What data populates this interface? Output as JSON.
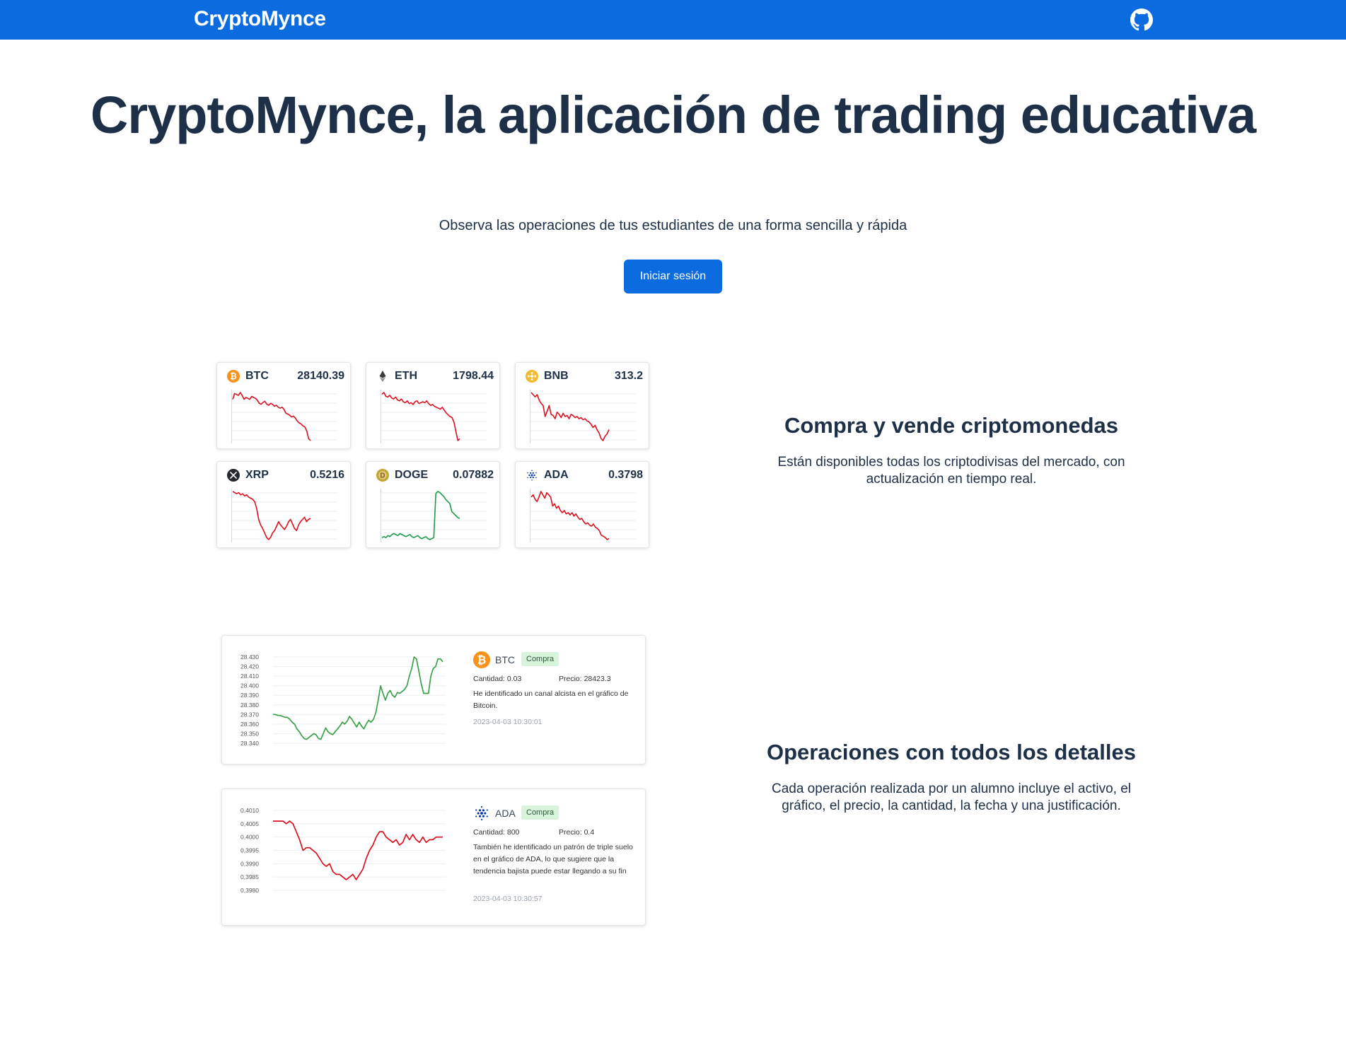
{
  "navbar": {
    "brand": "CryptoMynce",
    "github_icon": "github-icon",
    "bg_color": "#0b6bdf"
  },
  "hero": {
    "title": "CryptoMynce, la aplicación de trading educativa",
    "subtitle": "Observa las operaciones de tus estudiantes de una forma sencilla y rápida",
    "login_button": "Iniciar sesión"
  },
  "tickers": [
    {
      "symbol": "BTC",
      "price": "28140.39",
      "icon": "btc-icon",
      "trend": "down",
      "color": "#d9121f",
      "series": [
        52,
        58,
        57,
        56,
        59,
        56,
        52,
        54,
        53,
        52,
        55,
        54,
        53,
        51,
        48,
        47,
        49,
        50,
        47,
        46,
        48,
        47,
        45,
        46,
        44,
        43,
        44,
        42,
        38,
        37,
        36,
        34,
        35,
        33,
        30,
        28,
        27,
        25,
        24,
        20,
        12,
        10
      ]
    },
    {
      "symbol": "ETH",
      "price": "1798.44",
      "icon": "eth-icon",
      "trend": "down",
      "color": "#d9121f",
      "series": [
        60,
        62,
        58,
        57,
        59,
        56,
        55,
        57,
        54,
        53,
        55,
        52,
        51,
        53,
        50,
        51,
        49,
        52,
        53,
        50,
        51,
        52,
        51,
        53,
        50,
        48,
        49,
        47,
        46,
        45,
        44,
        46,
        43,
        40,
        38,
        36,
        35,
        30,
        20,
        10,
        12
      ]
    },
    {
      "symbol": "BNB",
      "price": "313.2",
      "icon": "bnb-icon",
      "trend": "down",
      "color": "#d9121f",
      "series": [
        62,
        60,
        58,
        60,
        55,
        52,
        50,
        40,
        45,
        50,
        42,
        41,
        38,
        44,
        42,
        39,
        43,
        40,
        41,
        38,
        42,
        41,
        39,
        40,
        38,
        39,
        37,
        38,
        36,
        35,
        33,
        30,
        32,
        28,
        25,
        20,
        18,
        22,
        24,
        28
      ]
    },
    {
      "symbol": "XRP",
      "price": "0.5216",
      "icon": "xrp-icon",
      "trend": "down",
      "color": "#d9121f",
      "series": [
        55,
        54,
        53,
        54,
        52,
        53,
        51,
        52,
        50,
        49,
        48,
        46,
        40,
        30,
        25,
        22,
        18,
        14,
        12,
        14,
        18,
        20,
        24,
        28,
        25,
        23,
        21,
        24,
        28,
        30,
        26,
        22,
        20,
        25,
        28,
        30,
        32,
        28,
        30,
        31
      ]
    },
    {
      "symbol": "DOGE",
      "price": "0.07882",
      "icon": "doge-icon",
      "trend": "up",
      "color": "#1f9a4a",
      "series": [
        14,
        15,
        14,
        16,
        15,
        17,
        18,
        17,
        16,
        18,
        17,
        16,
        15,
        16,
        17,
        15,
        14,
        15,
        16,
        14,
        13,
        14,
        15,
        13,
        12,
        13,
        14,
        58,
        60,
        59,
        57,
        55,
        52,
        50,
        48,
        40,
        38,
        36,
        34,
        33
      ]
    },
    {
      "symbol": "ADA",
      "price": "0.3798",
      "icon": "ada-icon",
      "trend": "down",
      "color": "#d9121f",
      "series": [
        50,
        52,
        48,
        46,
        50,
        55,
        52,
        49,
        54,
        52,
        50,
        42,
        44,
        40,
        42,
        38,
        36,
        38,
        35,
        36,
        34,
        36,
        33,
        35,
        32,
        30,
        31,
        28,
        26,
        27,
        25,
        24,
        26,
        23,
        22,
        20,
        16,
        15,
        14,
        12,
        13
      ]
    }
  ],
  "features": [
    {
      "title": "Compra y vende criptomonedas",
      "text": "Están disponibles todas los criptodivisas del mercado, con actualización en tiempo real."
    },
    {
      "title": "Operaciones con todos los detalles",
      "text": "Cada operación realizada por un alumno incluye el activo, el gráfico, el precio, la cantidad, la fecha y una justificación."
    }
  ],
  "operations": [
    {
      "symbol": "BTC",
      "icon": "btc-icon",
      "badge": "Compra",
      "quantity": "Cantidad: 0.03",
      "price": "Precio: 28423.3",
      "description": "He identificado un canal alcista en el gráfico de Bitcoin.",
      "timestamp": "2023-04-03 10:30:01",
      "chart_data": {
        "type": "line",
        "yticks": [
          "28.430",
          "28.420",
          "28.410",
          "28.400",
          "28.390",
          "28.380",
          "28.370",
          "28.360",
          "28.350",
          "28.340"
        ],
        "ylim": [
          28340,
          28430
        ],
        "color": "#3aa14a",
        "series": [
          28370,
          28370,
          28369,
          28369,
          28368,
          28367,
          28367,
          28365,
          28362,
          28360,
          28355,
          28352,
          28348,
          28345,
          28344,
          28346,
          28348,
          28350,
          28349,
          28345,
          28344,
          28350,
          28356,
          28352,
          28350,
          28349,
          28352,
          28355,
          28358,
          28362,
          28360,
          28363,
          28368,
          28365,
          28361,
          28357,
          28362,
          28358,
          28355,
          28360,
          28364,
          28362,
          28365,
          28372,
          28385,
          28400,
          28392,
          28385,
          28392,
          28395,
          28390,
          28388,
          28393,
          28392,
          28394,
          28396,
          28400,
          28410,
          28418,
          28430,
          28428,
          28415,
          28402,
          28392,
          28392,
          28392,
          28410,
          28418,
          28420,
          28428,
          28428,
          28425
        ]
      }
    },
    {
      "symbol": "ADA",
      "icon": "ada-icon",
      "badge": "Compra",
      "quantity": "Cantidad: 800",
      "price": "Precio: 0.4",
      "description": "También he identificado un patrón de triple suelo en el gráfico de ADA, lo que sugiere que la tendencia bajista puede estar llegando a su fin",
      "timestamp": "2023-04-03 10:30:57",
      "chart_data": {
        "type": "line",
        "yticks": [
          "0,4010",
          "0,4005",
          "0,4000",
          "0,3995",
          "0,3990",
          "0,3985",
          "0,3980"
        ],
        "ylim": [
          0.398,
          0.401
        ],
        "color": "#d9121f",
        "series": [
          0.4006,
          0.4006,
          0.4006,
          0.4006,
          0.4005,
          0.4006,
          0.4005,
          0.4002,
          0.3999,
          0.3995,
          0.3996,
          0.3996,
          0.3995,
          0.3994,
          0.3992,
          0.399,
          0.3989,
          0.399,
          0.3987,
          0.3986,
          0.3986,
          0.3985,
          0.3984,
          0.3985,
          0.3986,
          0.3984,
          0.3986,
          0.3988,
          0.3992,
          0.3995,
          0.3997,
          0.4,
          0.4002,
          0.4002,
          0.4,
          0.3999,
          0.3998,
          0.3999,
          0.3997,
          0.3998,
          0.4001,
          0.3999,
          0.4001,
          0.3999,
          0.3998,
          0.4,
          0.3998,
          0.3999,
          0.3999,
          0.4,
          0.4,
          0.4
        ]
      }
    }
  ]
}
